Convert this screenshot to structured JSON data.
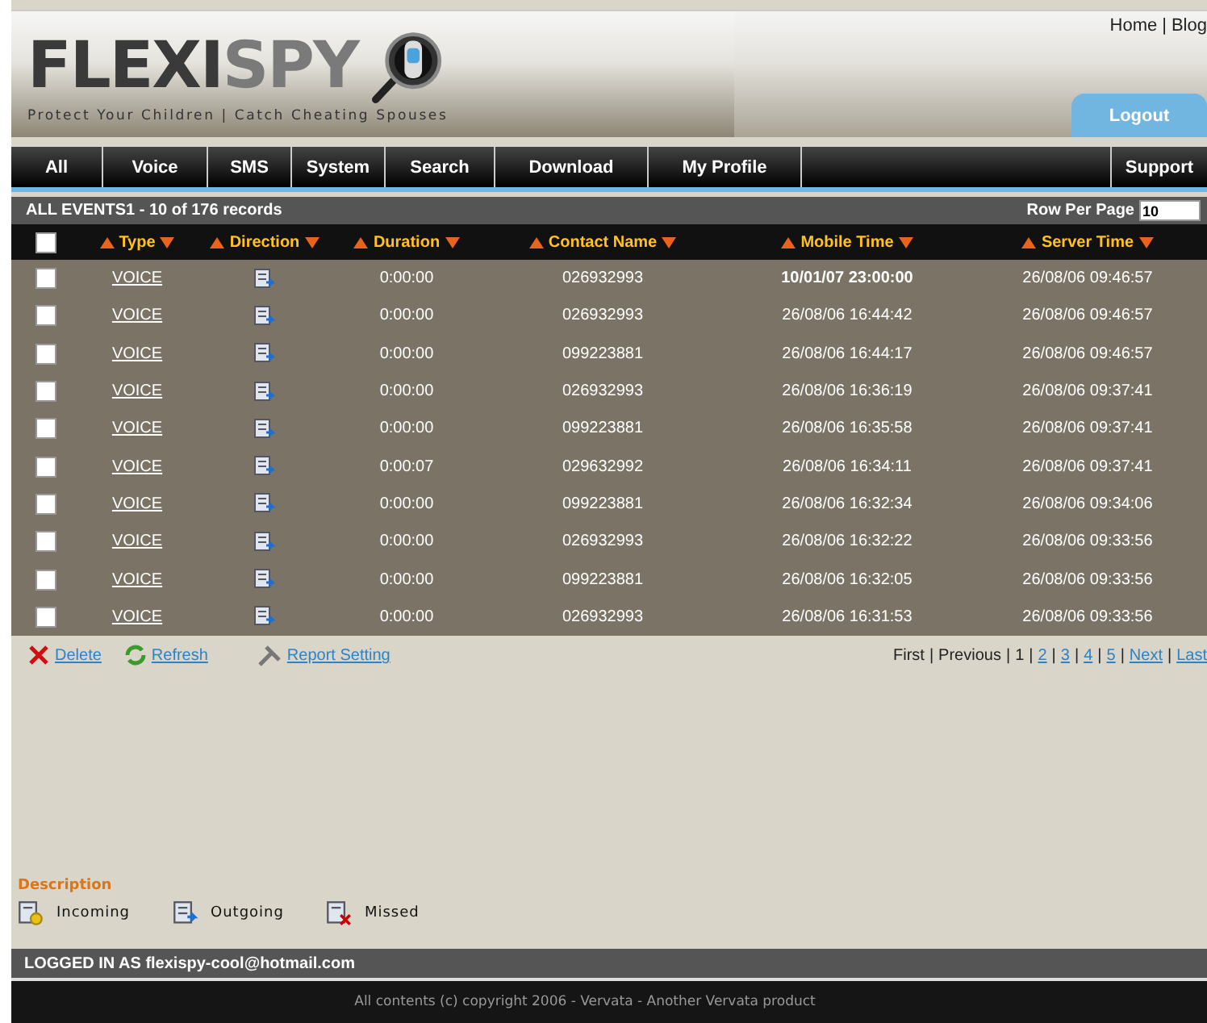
{
  "header": {
    "logo_part1": "FLEXI",
    "logo_part2": "SPY",
    "tagline": "Protect Your Children | Catch Cheating Spouses",
    "top_links": [
      "Home",
      "Blog"
    ],
    "link_separator": "|",
    "logout": "Logout"
  },
  "nav": [
    {
      "label": "All",
      "selected": false
    },
    {
      "label": "Voice",
      "selected": false
    },
    {
      "label": "SMS",
      "selected": false
    },
    {
      "label": "System",
      "selected": false
    },
    {
      "label": "Search",
      "selected": false
    },
    {
      "label": "Download",
      "selected": false
    },
    {
      "label": "My Profile",
      "selected": false
    },
    {
      "label": "Support",
      "selected": false
    }
  ],
  "table": {
    "title": "ALL EVENTS1 - 10 of 176 records",
    "rows_per_page_label": "Row Per Page",
    "rows_per_page": "10",
    "columns": [
      "Type",
      "Direction",
      "Duration",
      "Contact Name",
      "Mobile Time",
      "Server Time"
    ],
    "rows": [
      {
        "checked": false,
        "type": "VOICE",
        "kind": "outgoing",
        "duration": "0:00:00",
        "contact": "026932993",
        "mobile_time": "10/01/07 23:00:00",
        "server_time": "26/08/06 09:46:57",
        "bold": true
      },
      {
        "checked": false,
        "type": "VOICE",
        "kind": "outgoing",
        "duration": "0:00:00",
        "contact": "026932993",
        "mobile_time": "26/08/06 16:44:42",
        "server_time": "26/08/06 09:46:57",
        "bold": false
      },
      {
        "checked": false,
        "type": "VOICE",
        "kind": "outgoing",
        "duration": "0:00:00",
        "contact": "099223881",
        "mobile_time": "26/08/06 16:44:17",
        "server_time": "26/08/06 09:46:57",
        "bold": false
      },
      {
        "checked": false,
        "type": "VOICE",
        "kind": "outgoing",
        "duration": "0:00:00",
        "contact": "026932993",
        "mobile_time": "26/08/06 16:36:19",
        "server_time": "26/08/06 09:37:41",
        "bold": false
      },
      {
        "checked": false,
        "type": "VOICE",
        "kind": "outgoing",
        "duration": "0:00:00",
        "contact": "099223881",
        "mobile_time": "26/08/06 16:35:58",
        "server_time": "26/08/06 09:37:41",
        "bold": false
      },
      {
        "checked": false,
        "type": "VOICE",
        "kind": "outgoing",
        "duration": "0:00:07",
        "contact": "029632992",
        "mobile_time": "26/08/06 16:34:11",
        "server_time": "26/08/06 09:37:41",
        "bold": false
      },
      {
        "checked": false,
        "type": "VOICE",
        "kind": "outgoing",
        "duration": "0:00:00",
        "contact": "099223881",
        "mobile_time": "26/08/06 16:32:34",
        "server_time": "26/08/06 09:34:06",
        "bold": false
      },
      {
        "checked": false,
        "type": "VOICE",
        "kind": "outgoing",
        "duration": "0:00:00",
        "contact": "026932993",
        "mobile_time": "26/08/06 16:32:22",
        "server_time": "26/08/06 09:33:56",
        "bold": false
      },
      {
        "checked": false,
        "type": "VOICE",
        "kind": "outgoing",
        "duration": "0:00:00",
        "contact": "099223881",
        "mobile_time": "26/08/06 16:32:05",
        "server_time": "26/08/06 09:33:56",
        "bold": false
      },
      {
        "checked": false,
        "type": "VOICE",
        "kind": "outgoing",
        "duration": "0:00:00",
        "contact": "026932993",
        "mobile_time": "26/08/06 16:31:53",
        "server_time": "26/08/06 09:33:56",
        "bold": false
      }
    ],
    "select_all_checked": false
  },
  "actions": [
    {
      "kind": "delete",
      "label": "Delete"
    },
    {
      "kind": "refresh",
      "label": "Refresh"
    },
    {
      "kind": "settings",
      "label": "Report Setting"
    }
  ],
  "pagination": [
    {
      "label": "First",
      "link": false
    },
    {
      "label": "Previous",
      "link": false
    },
    {
      "label": "1",
      "link": false
    },
    {
      "label": "2",
      "link": true
    },
    {
      "label": "3",
      "link": true
    },
    {
      "label": "4",
      "link": true
    },
    {
      "label": "5",
      "link": true
    },
    {
      "label": "Next",
      "link": true
    },
    {
      "label": "Last",
      "link": true
    }
  ],
  "pagination_separator": "|",
  "legend": {
    "title": "Description",
    "items": [
      {
        "kind": "incoming",
        "label": "Incoming"
      },
      {
        "kind": "outgoing",
        "label": "Outgoing"
      },
      {
        "kind": "missed",
        "label": "Missed"
      }
    ]
  },
  "logged_in": "LOGGED IN AS flexispy-cool@hotmail.com",
  "copyright": "All contents (c) copyright 2006 - Vervata - Another Vervata product"
}
